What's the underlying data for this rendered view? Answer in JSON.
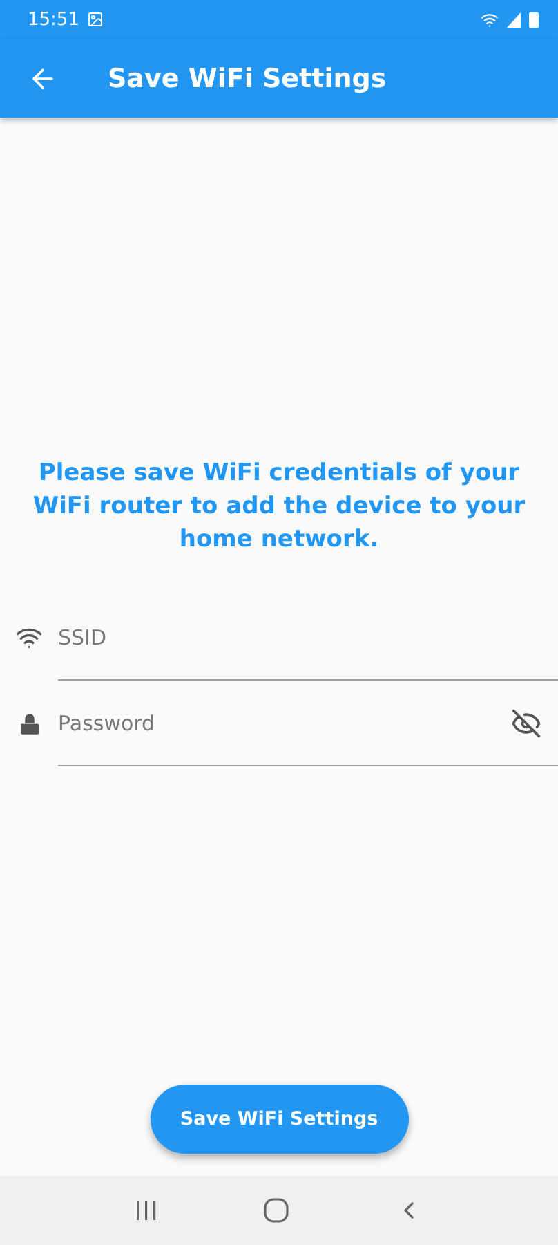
{
  "status_bar": {
    "time": "15:51"
  },
  "app_bar": {
    "title": "Save WiFi Settings"
  },
  "message": "Please save WiFi credentials of your WiFi router to add the device to your home network.",
  "fields": [
    {
      "kind": "wifi",
      "placeholder": "SSID"
    },
    {
      "kind": "password",
      "placeholder": "Password",
      "visible": false
    }
  ],
  "button": "Save WiFi Settings"
}
